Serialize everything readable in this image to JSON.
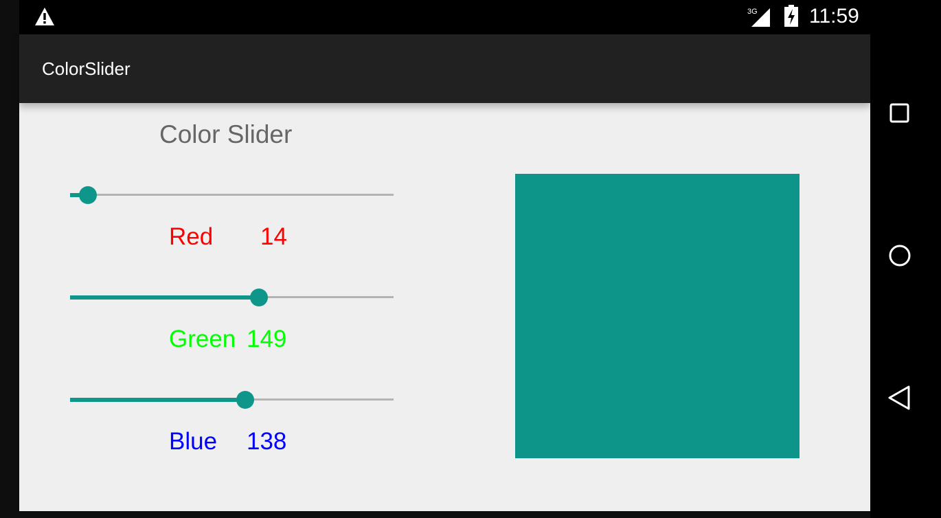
{
  "status_bar": {
    "time": "11:59",
    "network_label": "3G",
    "icons": [
      "warning-icon",
      "signal-3g-icon",
      "battery-charging-icon"
    ]
  },
  "app": {
    "title": "ColorSlider"
  },
  "heading": "Color Slider",
  "sliders": [
    {
      "name": "Red",
      "value": "14",
      "max": 255,
      "color": "#ff0000"
    },
    {
      "name": "Green",
      "value": "149",
      "max": 255,
      "color": "#00ff00"
    },
    {
      "name": "Blue",
      "value": "138",
      "max": 255,
      "color": "#0000ff"
    }
  ],
  "accent_color": "#0f968a",
  "preview_color": "#0e9589",
  "nav_icons": [
    "recents-square-icon",
    "home-circle-icon",
    "back-triangle-icon"
  ]
}
